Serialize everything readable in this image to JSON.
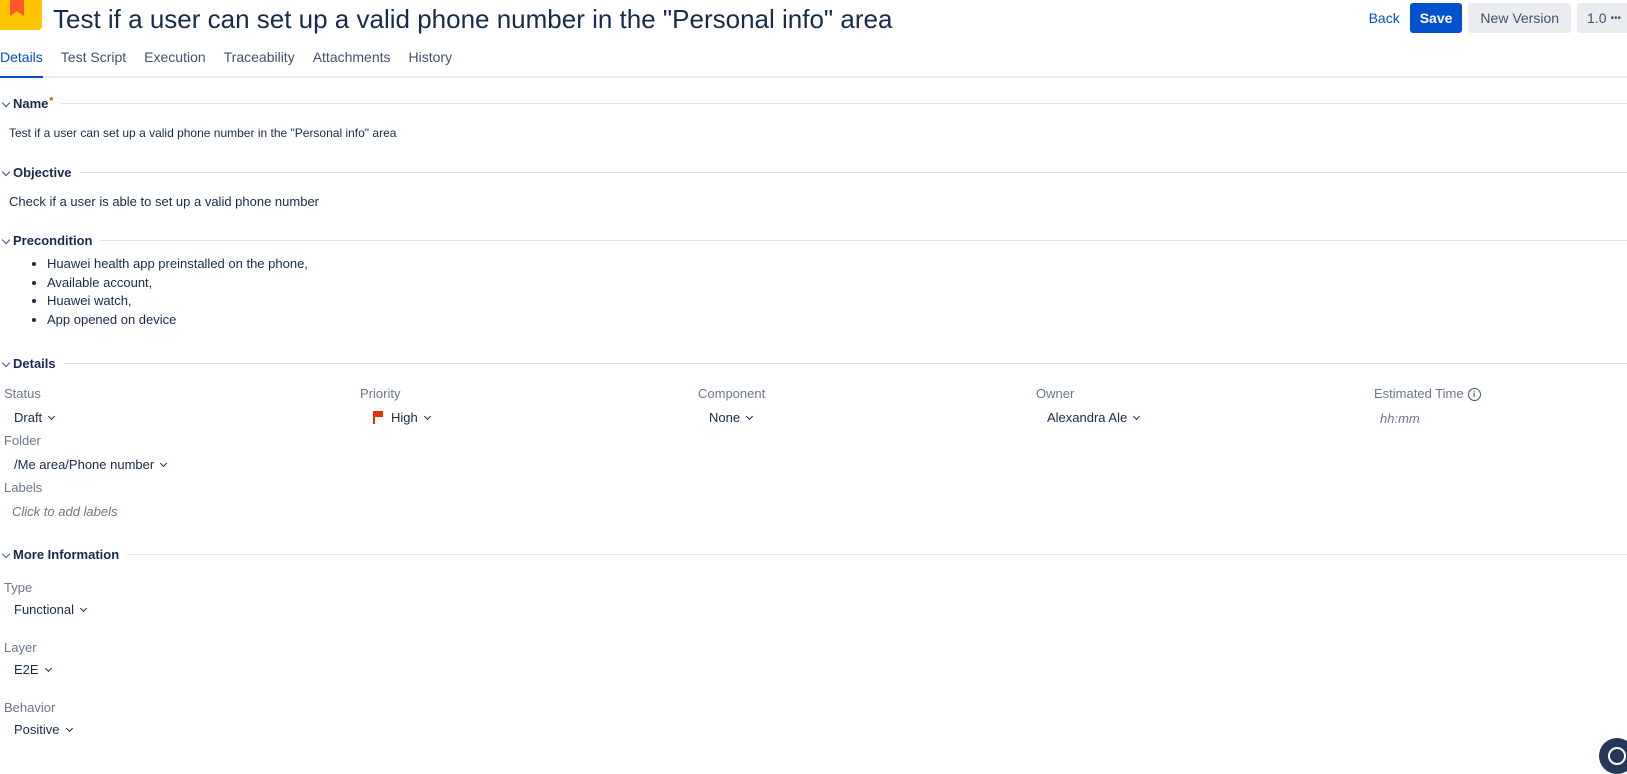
{
  "header": {
    "title": "Test if a user can set up a valid phone number in the \"Personal info\" area",
    "back_label": "Back",
    "save_label": "Save",
    "new_version_label": "New Version",
    "version_label": "1.0",
    "more_label": "•••"
  },
  "tabs": [
    {
      "label": "Details",
      "active": true
    },
    {
      "label": "Test Script"
    },
    {
      "label": "Execution"
    },
    {
      "label": "Traceability"
    },
    {
      "label": "Attachments"
    },
    {
      "label": "History"
    }
  ],
  "sections": {
    "name": {
      "title": "Name",
      "required_mark": "*",
      "value": "Test if a user can set up a valid phone number in the \"Personal info\" area"
    },
    "objective": {
      "title": "Objective",
      "value": "Check if a user is able to set up a valid phone number"
    },
    "precondition": {
      "title": "Precondition",
      "items": [
        "Huawei health app preinstalled on the phone,",
        "Available account,",
        "Huawei watch,",
        "App opened on device"
      ]
    },
    "details": {
      "title": "Details",
      "status": {
        "label": "Status",
        "value": "Draft"
      },
      "priority": {
        "label": "Priority",
        "value": "High"
      },
      "component": {
        "label": "Component",
        "value": "None"
      },
      "owner": {
        "label": "Owner",
        "value": "Alexandra Ale"
      },
      "estimated_time": {
        "label": "Estimated Time",
        "placeholder": "hh:mm"
      },
      "folder": {
        "label": "Folder",
        "value": "/Me area/Phone number"
      },
      "labels": {
        "label": "Labels",
        "placeholder": "Click to add labels"
      }
    },
    "more_information": {
      "title": "More Information",
      "type": {
        "label": "Type",
        "value": "Functional"
      },
      "layer": {
        "label": "Layer",
        "value": "E2E"
      },
      "behavior": {
        "label": "Behavior",
        "value": "Positive"
      }
    }
  },
  "colors": {
    "primary": "#0052cc",
    "priority_high": "#de350b",
    "text": "#172b4d",
    "muted": "#6b778c"
  }
}
